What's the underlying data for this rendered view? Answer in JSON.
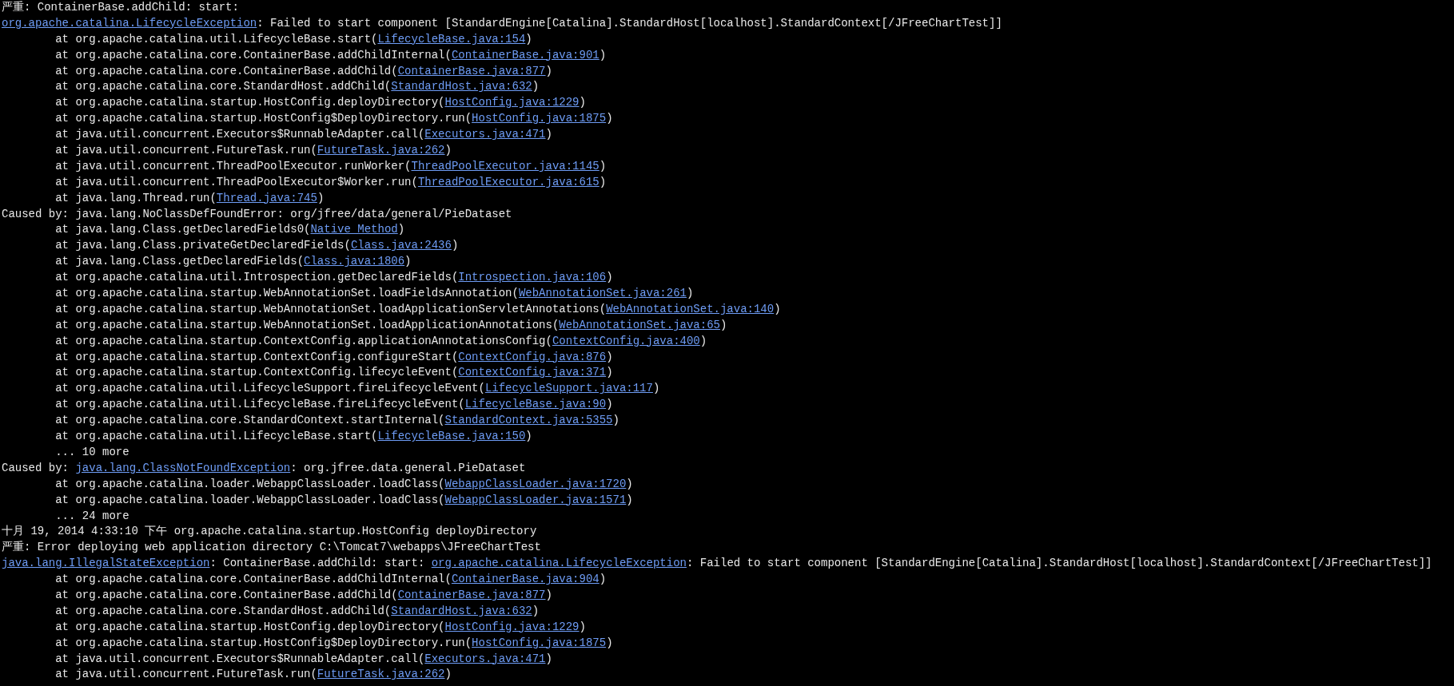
{
  "console": {
    "lines": [
      {
        "indented": false,
        "parts": [
          {
            "text": "严重: ContainerBase.addChild: start:",
            "link": false
          }
        ]
      },
      {
        "indented": false,
        "parts": [
          {
            "text": "org.apache.catalina.LifecycleException",
            "link": true
          },
          {
            "text": ": Failed to start component [StandardEngine[Catalina].StandardHost[localhost].StandardContext[/JFreeChartTest]]",
            "link": false
          }
        ]
      },
      {
        "indented": true,
        "parts": [
          {
            "text": "at org.apache.catalina.util.LifecycleBase.start(",
            "link": false
          },
          {
            "text": "LifecycleBase.java:154",
            "link": true
          },
          {
            "text": ")",
            "link": false
          }
        ]
      },
      {
        "indented": true,
        "parts": [
          {
            "text": "at org.apache.catalina.core.ContainerBase.addChildInternal(",
            "link": false
          },
          {
            "text": "ContainerBase.java:901",
            "link": true
          },
          {
            "text": ")",
            "link": false
          }
        ]
      },
      {
        "indented": true,
        "parts": [
          {
            "text": "at org.apache.catalina.core.ContainerBase.addChild(",
            "link": false
          },
          {
            "text": "ContainerBase.java:877",
            "link": true
          },
          {
            "text": ")",
            "link": false
          }
        ]
      },
      {
        "indented": true,
        "parts": [
          {
            "text": "at org.apache.catalina.core.StandardHost.addChild(",
            "link": false
          },
          {
            "text": "StandardHost.java:632",
            "link": true
          },
          {
            "text": ")",
            "link": false
          }
        ]
      },
      {
        "indented": true,
        "parts": [
          {
            "text": "at org.apache.catalina.startup.HostConfig.deployDirectory(",
            "link": false
          },
          {
            "text": "HostConfig.java:1229",
            "link": true
          },
          {
            "text": ")",
            "link": false
          }
        ]
      },
      {
        "indented": true,
        "parts": [
          {
            "text": "at org.apache.catalina.startup.HostConfig$DeployDirectory.run(",
            "link": false
          },
          {
            "text": "HostConfig.java:1875",
            "link": true
          },
          {
            "text": ")",
            "link": false
          }
        ]
      },
      {
        "indented": true,
        "parts": [
          {
            "text": "at java.util.concurrent.Executors$RunnableAdapter.call(",
            "link": false
          },
          {
            "text": "Executors.java:471",
            "link": true
          },
          {
            "text": ")",
            "link": false
          }
        ]
      },
      {
        "indented": true,
        "parts": [
          {
            "text": "at java.util.concurrent.FutureTask.run(",
            "link": false
          },
          {
            "text": "FutureTask.java:262",
            "link": true
          },
          {
            "text": ")",
            "link": false
          }
        ]
      },
      {
        "indented": true,
        "parts": [
          {
            "text": "at java.util.concurrent.ThreadPoolExecutor.runWorker(",
            "link": false
          },
          {
            "text": "ThreadPoolExecutor.java:1145",
            "link": true
          },
          {
            "text": ")",
            "link": false
          }
        ]
      },
      {
        "indented": true,
        "parts": [
          {
            "text": "at java.util.concurrent.ThreadPoolExecutor$Worker.run(",
            "link": false
          },
          {
            "text": "ThreadPoolExecutor.java:615",
            "link": true
          },
          {
            "text": ")",
            "link": false
          }
        ]
      },
      {
        "indented": true,
        "parts": [
          {
            "text": "at java.lang.Thread.run(",
            "link": false
          },
          {
            "text": "Thread.java:745",
            "link": true
          },
          {
            "text": ")",
            "link": false
          }
        ]
      },
      {
        "indented": false,
        "parts": [
          {
            "text": "Caused by: java.lang.NoClassDefFoundError: org/jfree/data/general/PieDataset",
            "link": false
          }
        ]
      },
      {
        "indented": true,
        "parts": [
          {
            "text": "at java.lang.Class.getDeclaredFields0(",
            "link": false
          },
          {
            "text": "Native Method",
            "link": true
          },
          {
            "text": ")",
            "link": false
          }
        ]
      },
      {
        "indented": true,
        "parts": [
          {
            "text": "at java.lang.Class.privateGetDeclaredFields(",
            "link": false
          },
          {
            "text": "Class.java:2436",
            "link": true
          },
          {
            "text": ")",
            "link": false
          }
        ]
      },
      {
        "indented": true,
        "parts": [
          {
            "text": "at java.lang.Class.getDeclaredFields(",
            "link": false
          },
          {
            "text": "Class.java:1806",
            "link": true
          },
          {
            "text": ")",
            "link": false
          }
        ]
      },
      {
        "indented": true,
        "parts": [
          {
            "text": "at org.apache.catalina.util.Introspection.getDeclaredFields(",
            "link": false
          },
          {
            "text": "Introspection.java:106",
            "link": true
          },
          {
            "text": ")",
            "link": false
          }
        ]
      },
      {
        "indented": true,
        "parts": [
          {
            "text": "at org.apache.catalina.startup.WebAnnotationSet.loadFieldsAnnotation(",
            "link": false
          },
          {
            "text": "WebAnnotationSet.java:261",
            "link": true
          },
          {
            "text": ")",
            "link": false
          }
        ]
      },
      {
        "indented": true,
        "parts": [
          {
            "text": "at org.apache.catalina.startup.WebAnnotationSet.loadApplicationServletAnnotations(",
            "link": false
          },
          {
            "text": "WebAnnotationSet.java:140",
            "link": true
          },
          {
            "text": ")",
            "link": false
          }
        ]
      },
      {
        "indented": true,
        "parts": [
          {
            "text": "at org.apache.catalina.startup.WebAnnotationSet.loadApplicationAnnotations(",
            "link": false
          },
          {
            "text": "WebAnnotationSet.java:65",
            "link": true
          },
          {
            "text": ")",
            "link": false
          }
        ]
      },
      {
        "indented": true,
        "parts": [
          {
            "text": "at org.apache.catalina.startup.ContextConfig.applicationAnnotationsConfig(",
            "link": false
          },
          {
            "text": "ContextConfig.java:400",
            "link": true
          },
          {
            "text": ")",
            "link": false
          }
        ]
      },
      {
        "indented": true,
        "parts": [
          {
            "text": "at org.apache.catalina.startup.ContextConfig.configureStart(",
            "link": false
          },
          {
            "text": "ContextConfig.java:876",
            "link": true
          },
          {
            "text": ")",
            "link": false
          }
        ]
      },
      {
        "indented": true,
        "parts": [
          {
            "text": "at org.apache.catalina.startup.ContextConfig.lifecycleEvent(",
            "link": false
          },
          {
            "text": "ContextConfig.java:371",
            "link": true
          },
          {
            "text": ")",
            "link": false
          }
        ]
      },
      {
        "indented": true,
        "parts": [
          {
            "text": "at org.apache.catalina.util.LifecycleSupport.fireLifecycleEvent(",
            "link": false
          },
          {
            "text": "LifecycleSupport.java:117",
            "link": true
          },
          {
            "text": ")",
            "link": false
          }
        ]
      },
      {
        "indented": true,
        "parts": [
          {
            "text": "at org.apache.catalina.util.LifecycleBase.fireLifecycleEvent(",
            "link": false
          },
          {
            "text": "LifecycleBase.java:90",
            "link": true
          },
          {
            "text": ")",
            "link": false
          }
        ]
      },
      {
        "indented": true,
        "parts": [
          {
            "text": "at org.apache.catalina.core.StandardContext.startInternal(",
            "link": false
          },
          {
            "text": "StandardContext.java:5355",
            "link": true
          },
          {
            "text": ")",
            "link": false
          }
        ]
      },
      {
        "indented": true,
        "parts": [
          {
            "text": "at org.apache.catalina.util.LifecycleBase.start(",
            "link": false
          },
          {
            "text": "LifecycleBase.java:150",
            "link": true
          },
          {
            "text": ")",
            "link": false
          }
        ]
      },
      {
        "indented": true,
        "parts": [
          {
            "text": "... 10 more",
            "link": false
          }
        ]
      },
      {
        "indented": false,
        "parts": [
          {
            "text": "Caused by: ",
            "link": false
          },
          {
            "text": "java.lang.ClassNotFoundException",
            "link": true
          },
          {
            "text": ": org.jfree.data.general.PieDataset",
            "link": false
          }
        ]
      },
      {
        "indented": true,
        "parts": [
          {
            "text": "at org.apache.catalina.loader.WebappClassLoader.loadClass(",
            "link": false
          },
          {
            "text": "WebappClassLoader.java:1720",
            "link": true
          },
          {
            "text": ")",
            "link": false
          }
        ]
      },
      {
        "indented": true,
        "parts": [
          {
            "text": "at org.apache.catalina.loader.WebappClassLoader.loadClass(",
            "link": false
          },
          {
            "text": "WebappClassLoader.java:1571",
            "link": true
          },
          {
            "text": ")",
            "link": false
          }
        ]
      },
      {
        "indented": true,
        "parts": [
          {
            "text": "... 24 more",
            "link": false
          }
        ]
      },
      {
        "indented": false,
        "parts": [
          {
            "text": "十月 19, 2014 4:33:10 下午 org.apache.catalina.startup.HostConfig deployDirectory",
            "link": false
          }
        ]
      },
      {
        "indented": false,
        "parts": [
          {
            "text": "严重: Error deploying web application directory C:\\Tomcat7\\webapps\\JFreeChartTest",
            "link": false
          }
        ]
      },
      {
        "indented": false,
        "parts": [
          {
            "text": "java.lang.IllegalStateException",
            "link": true
          },
          {
            "text": ": ContainerBase.addChild: start: ",
            "link": false
          },
          {
            "text": "org.apache.catalina.LifecycleException",
            "link": true
          },
          {
            "text": ": Failed to start component [StandardEngine[Catalina].StandardHost[localhost].StandardContext[/JFreeChartTest]]",
            "link": false
          }
        ]
      },
      {
        "indented": true,
        "parts": [
          {
            "text": "at org.apache.catalina.core.ContainerBase.addChildInternal(",
            "link": false
          },
          {
            "text": "ContainerBase.java:904",
            "link": true
          },
          {
            "text": ")",
            "link": false
          }
        ]
      },
      {
        "indented": true,
        "parts": [
          {
            "text": "at org.apache.catalina.core.ContainerBase.addChild(",
            "link": false
          },
          {
            "text": "ContainerBase.java:877",
            "link": true
          },
          {
            "text": ")",
            "link": false
          }
        ]
      },
      {
        "indented": true,
        "parts": [
          {
            "text": "at org.apache.catalina.core.StandardHost.addChild(",
            "link": false
          },
          {
            "text": "StandardHost.java:632",
            "link": true
          },
          {
            "text": ")",
            "link": false
          }
        ]
      },
      {
        "indented": true,
        "parts": [
          {
            "text": "at org.apache.catalina.startup.HostConfig.deployDirectory(",
            "link": false
          },
          {
            "text": "HostConfig.java:1229",
            "link": true
          },
          {
            "text": ")",
            "link": false
          }
        ]
      },
      {
        "indented": true,
        "parts": [
          {
            "text": "at org.apache.catalina.startup.HostConfig$DeployDirectory.run(",
            "link": false
          },
          {
            "text": "HostConfig.java:1875",
            "link": true
          },
          {
            "text": ")",
            "link": false
          }
        ]
      },
      {
        "indented": true,
        "parts": [
          {
            "text": "at java.util.concurrent.Executors$RunnableAdapter.call(",
            "link": false
          },
          {
            "text": "Executors.java:471",
            "link": true
          },
          {
            "text": ")",
            "link": false
          }
        ]
      },
      {
        "indented": true,
        "parts": [
          {
            "text": "at java.util.concurrent.FutureTask.run(",
            "link": false
          },
          {
            "text": "FutureTask.java:262",
            "link": true
          },
          {
            "text": ")",
            "link": false
          }
        ]
      }
    ]
  }
}
